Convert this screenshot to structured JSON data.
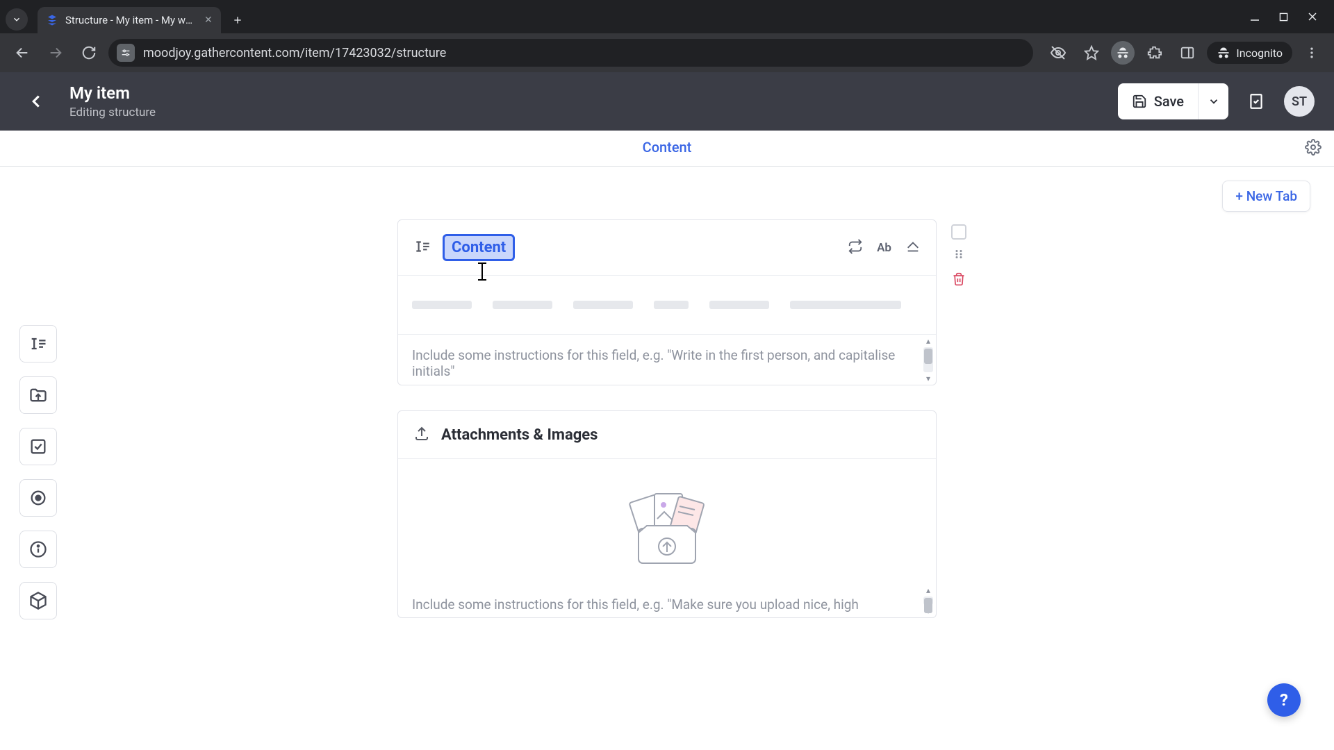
{
  "browser": {
    "tab_title": "Structure - My item - My websi",
    "url": "moodjoy.gathercontent.com/item/17423032/structure",
    "incognito_label": "Incognito"
  },
  "app": {
    "item_name": "My item",
    "subtitle": "Editing structure",
    "save_label": "Save",
    "avatar": "ST"
  },
  "tabs": {
    "active": "Content",
    "new_tab_label": "+ New Tab"
  },
  "fields": {
    "content": {
      "name": "Content",
      "instruction_placeholder": "Include some instructions for this field, e.g. \"Write in the first person, and capitalise initials\""
    },
    "attachments": {
      "name": "Attachments & Images",
      "instruction_placeholder": "Include some instructions for this field, e.g. \"Make sure you upload nice, high"
    }
  },
  "toolbar_icons": {
    "ab": "Ab"
  },
  "help": "?"
}
